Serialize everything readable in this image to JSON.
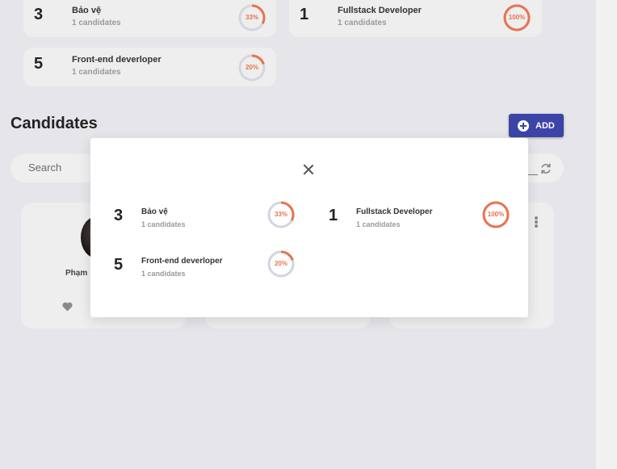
{
  "jobs": [
    {
      "count": "3",
      "title": "Bảo vệ",
      "candidates": "1 candidates",
      "percent_label": "33%",
      "percent": 0.33
    },
    {
      "count": "1",
      "title": "Fullstack Developer",
      "candidates": "1 candidates",
      "percent_label": "100%",
      "percent": 1.0
    },
    {
      "count": "5",
      "title": "Front-end deverloper",
      "candidates": "1 candidates",
      "percent_label": "20%",
      "percent": 0.2
    }
  ],
  "section": {
    "title": "Candidates",
    "add_label": "ADD"
  },
  "search": {
    "placeholder": "Search"
  },
  "candidate": {
    "name": "Phạm"
  },
  "modal": {
    "items": [
      {
        "count": "3",
        "title": "Bảo vệ",
        "candidates": "1 candidates",
        "percent_label": "33%",
        "percent": 0.33
      },
      {
        "count": "1",
        "title": "Fullstack Developer",
        "candidates": "1 candidates",
        "percent_label": "100%",
        "percent": 1.0
      },
      {
        "count": "5",
        "title": "Front-end deverloper",
        "candidates": "1 candidates",
        "percent_label": "20%",
        "percent": 0.2
      }
    ]
  },
  "colors": {
    "accent": "#e8734f",
    "ring_track": "#d3d6dd",
    "button": "#3c44a8"
  }
}
